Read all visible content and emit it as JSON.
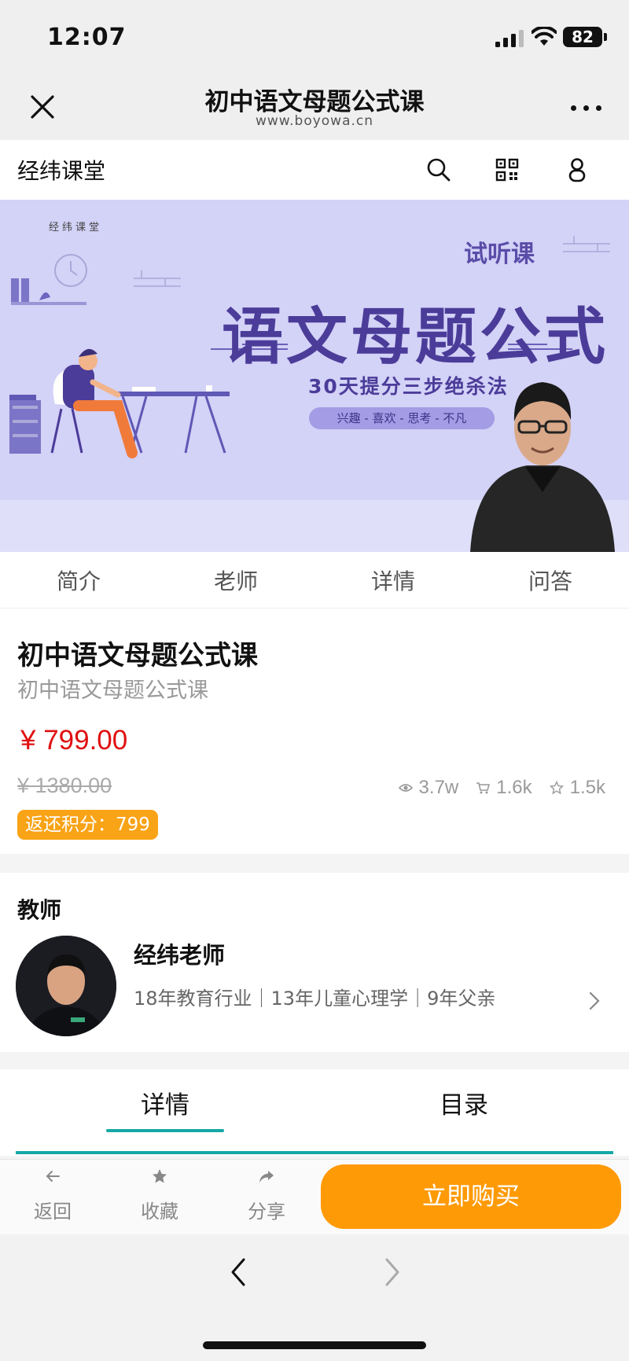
{
  "status": {
    "time": "12:07",
    "battery": "82"
  },
  "nav": {
    "title": "初中语文母题公式课",
    "url": "www.boyowa.cn"
  },
  "site": {
    "name": "经纬课堂"
  },
  "banner": {
    "brand": "经纬课堂",
    "trial": "试听课",
    "title": "语文母题公式",
    "subtitle": "30天提分三步绝杀法",
    "tagline": "兴趣 - 喜欢 - 思考 - 不凡"
  },
  "tabs": [
    "简介",
    "老师",
    "详情",
    "问答"
  ],
  "product": {
    "title": "初中语文母题公式课",
    "subtitle": "初中语文母题公式课",
    "price": "¥ 799.00",
    "old_price": "¥ 1380.00",
    "views": "3.7w",
    "sales": "1.6k",
    "favorites": "1.5k",
    "points": "返还积分：799"
  },
  "teacher": {
    "heading": "教师",
    "name": "经纬老师",
    "desc": "18年教育行业｜13年儿童心理学｜9年父亲"
  },
  "detail_tabs": {
    "details": "详情",
    "catalog": "目录"
  },
  "actions": {
    "back": "返回",
    "favorite": "收藏",
    "share": "分享",
    "buy": "立即购买"
  },
  "colors": {
    "accent": "#17a8a6",
    "price": "#e01010",
    "buy": "#ff9a07",
    "points": "#f9a316",
    "banner": "#d3d2f7"
  },
  "icons": [
    "close-icon",
    "more-icon",
    "search-icon",
    "qrcode-icon",
    "user-icon",
    "eye-icon",
    "cart-icon",
    "star-icon",
    "chevron-right-icon",
    "arrow-left-icon",
    "share-icon"
  ]
}
